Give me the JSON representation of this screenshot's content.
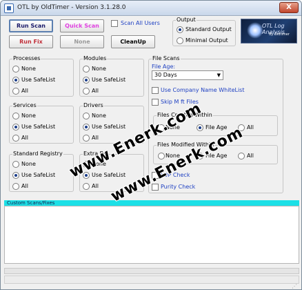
{
  "window": {
    "title": "OTL by OldTimer - Version 3.1.28.0",
    "close_label": "X"
  },
  "toolbar": {
    "run_scan": "Run Scan",
    "quick_scan": "Quick Scan",
    "run_fix": "Run Fix",
    "none": "None",
    "cleanup": "CleanUp",
    "scan_all_users": "Scan All Users",
    "quick_scan_color": "#e040e0",
    "run_fix_color": "#c0303a"
  },
  "output": {
    "title": "Output",
    "standard": "Standard Output",
    "minimal": "Minimal Output",
    "selected": "standard"
  },
  "logo": {
    "title": "OTL Log Analysis",
    "subtitle": "By Oldtimer"
  },
  "groups": {
    "processes": {
      "title": "Processes",
      "options": [
        "None",
        "Use SafeList",
        "All"
      ],
      "selected": 1
    },
    "modules": {
      "title": "Modules",
      "options": [
        "None",
        "Use SafeList",
        "All"
      ],
      "selected": 1
    },
    "services": {
      "title": "Services",
      "options": [
        "None",
        "Use SafeList",
        "All"
      ],
      "selected": 1
    },
    "drivers": {
      "title": "Drivers",
      "options": [
        "None",
        "Use SafeList",
        "All"
      ],
      "selected": 1
    },
    "standard_registry": {
      "title": "Standard Registry",
      "options": [
        "None",
        "Use SafeList",
        "All"
      ],
      "selected": 1
    },
    "extra_registry": {
      "title": "Extra Re",
      "options": [
        "None",
        "Use SafeList",
        "All"
      ],
      "selected": 1
    }
  },
  "file_scans": {
    "title": "File Scans",
    "file_age_label": "File Age:",
    "file_age_value": "30 Days",
    "use_company_whitelist": "Use Company Name WhiteList",
    "skip_files": "Skip M    ft Files",
    "files_created": {
      "title": "Files Created Within",
      "options": [
        "None",
        "File Age",
        "All"
      ],
      "selected": 1
    },
    "files_modified": {
      "title": "Files Modified Within",
      "options": [
        "None",
        "File Age",
        "All"
      ],
      "selected": 1
    },
    "lop_check": "LOP Check",
    "purity_check": "Purity Check"
  },
  "custom": {
    "label": "Custom Scans/Fixes"
  },
  "watermark": {
    "line1": "www.Enerk.com",
    "line2": "www.Enerk.com"
  }
}
